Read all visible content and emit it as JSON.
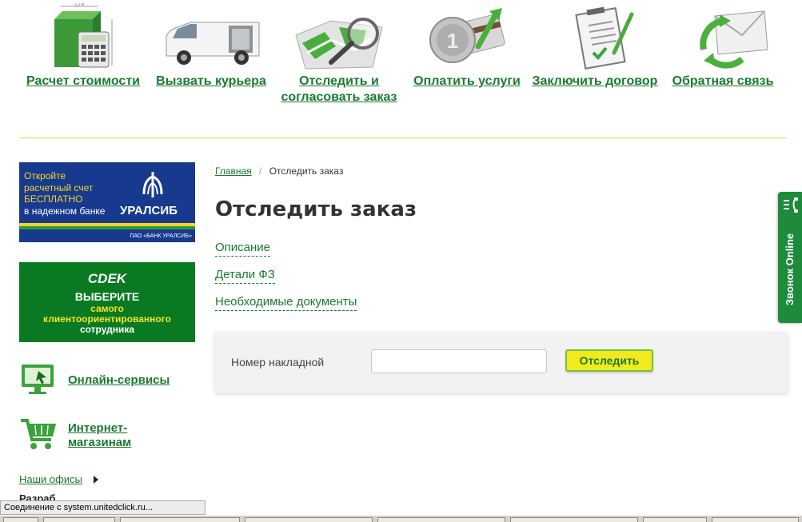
{
  "services": [
    {
      "label": "Расчет стоимости",
      "icon": "calculator-box-icon"
    },
    {
      "label": "Вызвать курьера",
      "icon": "courier-van-icon"
    },
    {
      "label": "Отследить и согласовать заказ",
      "icon": "map-magnifier-icon"
    },
    {
      "label": "Оплатить услуги",
      "icon": "payment-card-icon"
    },
    {
      "label": "Заключить договор",
      "icon": "contract-pen-icon"
    },
    {
      "label": "Обратная связь",
      "icon": "feedback-envelope-icon"
    }
  ],
  "banner_uralsib": {
    "line1": "Откройте",
    "line2": "расчетный счет",
    "line3": "БЕСПЛАТНО",
    "line4": "в надежном банке",
    "brand": "УРАЛСИБ",
    "small": "ПАО «БАНК УРАЛСИБ»"
  },
  "banner_cdek": {
    "brand": "СDEK",
    "line1": "ВЫБЕРИТЕ",
    "line2": "самого",
    "line3": "клиентоориентированного",
    "line4": "сотрудника"
  },
  "sidebar": {
    "online_services": "Онлайн-сервисы",
    "shops_line1": "Интернет-",
    "shops_line2": "магазинам",
    "offices": "Наши офисы",
    "cut_text": "Разраб"
  },
  "breadcrumb": {
    "home": "Главная",
    "separator": "/",
    "current": "Отследить заказ"
  },
  "page_title": "Отследить заказ",
  "sections": [
    "Описание",
    "Детали ФЗ",
    "Необходимые документы"
  ],
  "track_form": {
    "label": "Номер накладной",
    "value": "",
    "placeholder": "",
    "button": "Отследить"
  },
  "call_tab": {
    "label": "Звонок Online"
  },
  "status_bar": {
    "text": "Соединение с system.unitedclick.ru..."
  },
  "colors": {
    "brand_green": "#1a7a30",
    "button_yellow": "#f1ea1c",
    "uralsib_blue": "#173a8e",
    "cdek_green": "#0a7a22"
  }
}
